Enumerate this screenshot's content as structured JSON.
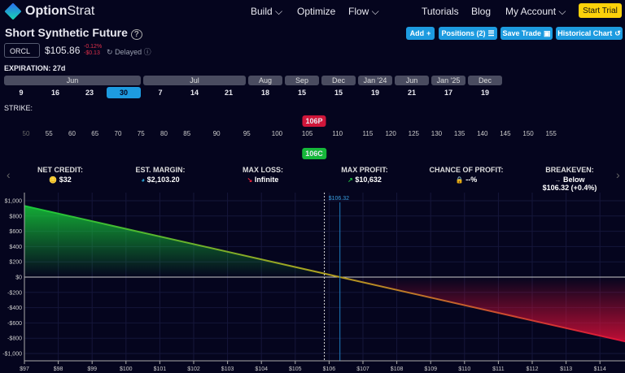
{
  "nav": {
    "brand_bold": "Option",
    "brand_light": "Strat",
    "items": [
      "Build",
      "Optimize",
      "Flow",
      "Tutorials",
      "Blog",
      "My Account"
    ],
    "trial": "Start Trial"
  },
  "title": "Short Synthetic Future",
  "buttons": {
    "add": "Add",
    "positions": "Positions (2)",
    "save": "Save Trade",
    "historical": "Historical Chart"
  },
  "quote": {
    "ticker": "ORCL",
    "price": "$105.86",
    "change_pct": "-0.12%",
    "change_abs": "-$0.13",
    "status": "Delayed"
  },
  "expiration": {
    "label": "EXPIRATION:",
    "value": "27d",
    "groups": [
      {
        "month": "Jun",
        "days": [
          "9",
          "16",
          "23",
          "30"
        ]
      },
      {
        "month": "Jul",
        "days": [
          "7",
          "14",
          "21"
        ]
      },
      {
        "month": "Aug",
        "days": [
          "18"
        ]
      },
      {
        "month": "Sep",
        "days": [
          "15"
        ]
      },
      {
        "month": "Dec",
        "days": [
          "15"
        ]
      },
      {
        "month": "Jan '24",
        "days": [
          "19"
        ]
      },
      {
        "month": "Jun",
        "days": [
          "21"
        ]
      },
      {
        "month": "Jan '25",
        "days": [
          "17"
        ]
      },
      {
        "month": "Dec",
        "days": [
          "19"
        ]
      }
    ],
    "selected": "30"
  },
  "strike": {
    "label": "STRIKE:",
    "ticks": [
      "50",
      "55",
      "60",
      "65",
      "70",
      "75",
      "80",
      "85",
      "90",
      "95",
      "100",
      "105",
      "110",
      "115",
      "120",
      "125",
      "130",
      "135",
      "140",
      "145",
      "150",
      "155"
    ],
    "put_tag": "106P",
    "call_tag": "106C",
    "put_color": "#d0163a",
    "call_color": "#16b83a"
  },
  "stats": [
    {
      "label": "NET CREDIT:",
      "value": "$32",
      "icon": "coins-icon"
    },
    {
      "label": "EST. MARGIN:",
      "value": "$2,103.20",
      "icon": "pie-icon"
    },
    {
      "label": "MAX LOSS:",
      "value": "Infinite",
      "icon": "arrow-down-right-icon"
    },
    {
      "label": "MAX PROFIT:",
      "value": "$10,632",
      "icon": "arrow-up-right-icon"
    },
    {
      "label": "CHANCE OF PROFIT:",
      "value": "--%",
      "icon": "lock-icon"
    },
    {
      "label": "BREAKEVEN:",
      "value": "Below $106.32 (+0.4%)",
      "icon": "arrow-right-icon"
    }
  ],
  "chart_data": {
    "type": "area",
    "x_ticks": [
      "$97",
      "$98",
      "$99",
      "$100",
      "$101",
      "$102",
      "$103",
      "$104",
      "$105",
      "$106",
      "$107",
      "$108",
      "$109",
      "$110",
      "$111",
      "$112",
      "$113",
      "$114"
    ],
    "y_ticks": [
      "$1,000",
      "$800",
      "$600",
      "$400",
      "$200",
      "$0",
      "-$200",
      "-$400",
      "-$600",
      "-$800",
      "-$1,000"
    ],
    "xlim": [
      97,
      114.85
    ],
    "ylim": [
      -1000,
      1000
    ],
    "points": [
      [
        97,
        932
      ],
      [
        114.85,
        -853
      ]
    ],
    "breakeven": 106.32,
    "breakeven_label": "$106.32",
    "current_price": 105.86,
    "profit_color": "#16c83a",
    "loss_color": "#e0103a"
  }
}
